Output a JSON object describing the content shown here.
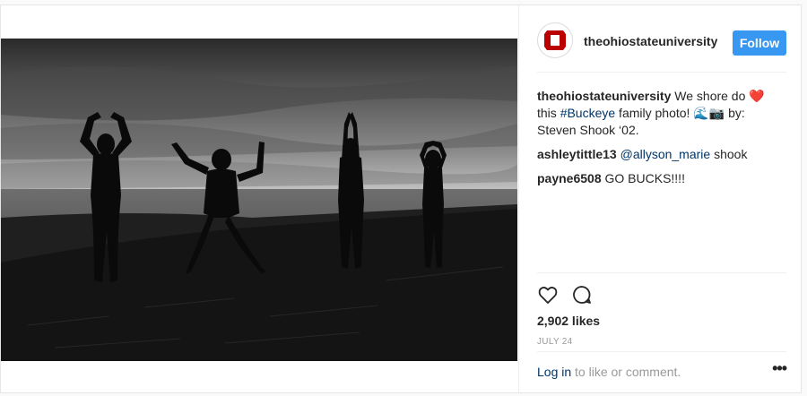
{
  "header": {
    "username": "theohiostateuniversity",
    "follow_label": "Follow"
  },
  "caption": {
    "username": "theohiostateuniversity",
    "text_1": " We shore do ",
    "heart": "❤️",
    "text_2": " this ",
    "hashtag": "#Buckeye",
    "text_3": " family photo! 🌊📷 by: Steven Shook ‘02."
  },
  "comments": [
    {
      "username": "ashleytittle13",
      "mention": "@allyson_marie",
      "text": " shook"
    },
    {
      "username": "payne6508",
      "text": " GO BUCKS!!!!"
    }
  ],
  "likes": "2,902 likes",
  "date": "JULY 24",
  "login": {
    "link": "Log in",
    "text": " to like or comment.",
    "more": "•••"
  },
  "colors": {
    "follow_bg": "#3897f0",
    "link": "#003569",
    "brand_red": "#bb0000"
  },
  "icons": [
    "like-heart-icon",
    "comment-bubble-icon",
    "more-options-icon",
    "ohio-state-block-o-logo"
  ]
}
